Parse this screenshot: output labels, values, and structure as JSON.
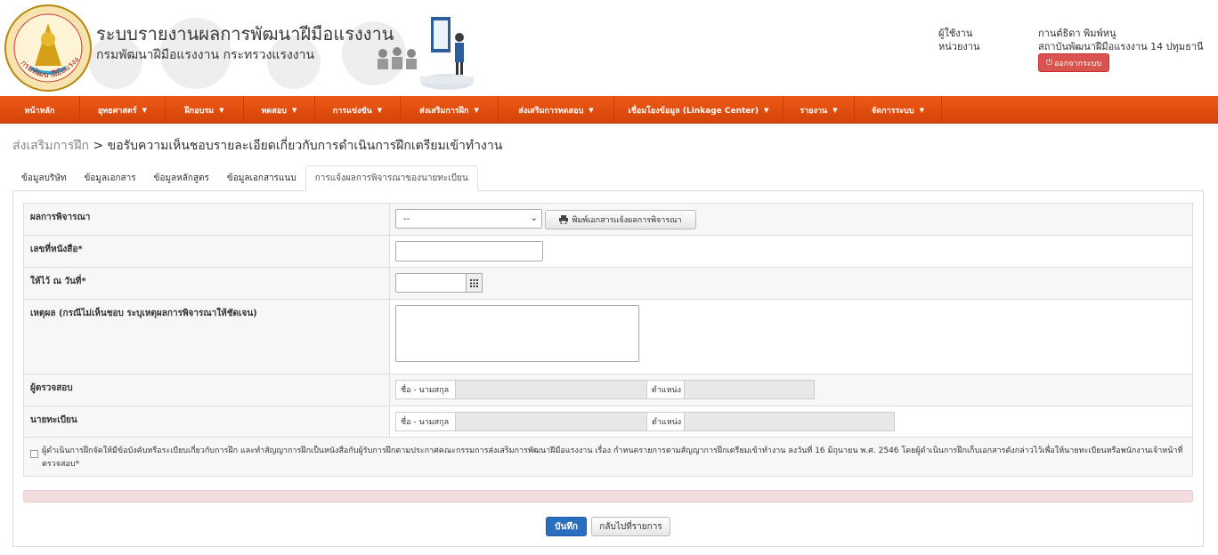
{
  "header": {
    "title": "ระบบรายงานผลการพัฒนาฝีมือแรงงาน",
    "subtitle": "กรมพัฒนาฝีมือแรงงาน กระทรวงแรงงาน",
    "logo_text": "กรมพัฒนาฝีมือแรงงาน",
    "user_label": "ผู้ใช้งาน",
    "unit_label": "หน่วยงาน",
    "user_name": "กานต์ธิดา พิมพ์หนู",
    "unit_name": "สถาบันพัฒนาฝีมือแรงงาน 14 ปทุมธานี",
    "logout_label": "ออกจากระบบ",
    "logout_icon": "power-icon"
  },
  "nav": {
    "items": [
      {
        "label": "หน้าหลัก",
        "dropdown": false
      },
      {
        "label": "ยุทธศาสตร์",
        "dropdown": true
      },
      {
        "label": "ฝึกอบรม",
        "dropdown": true
      },
      {
        "label": "ทดสอบ",
        "dropdown": true
      },
      {
        "label": "การแข่งขัน",
        "dropdown": true
      },
      {
        "label": "ส่งเสริมการฝึก",
        "dropdown": true
      },
      {
        "label": "ส่งเสริมการทดสอบ",
        "dropdown": true
      },
      {
        "label": "เชื่อมโยงข้อมูล (Linkage Center)",
        "dropdown": true
      },
      {
        "label": "รายงาน",
        "dropdown": true
      },
      {
        "label": "จัดการระบบ",
        "dropdown": true
      }
    ],
    "caret": "▼"
  },
  "breadcrumb": {
    "parent": "ส่งเสริมการฝึก",
    "separator": ">",
    "current": "ขอรับความเห็นชอบรายละเอียดเกี่ยวกับการดำเนินการฝึกเตรียมเข้าทำงาน"
  },
  "tabs": [
    {
      "label": "ข้อมูลบริษัท",
      "active": false
    },
    {
      "label": "ข้อมูลเอกสาร",
      "active": false
    },
    {
      "label": "ข้อมูลหลักสูตร",
      "active": false
    },
    {
      "label": "ข้อมูลเอกสารแนบ",
      "active": false
    },
    {
      "label": "การแจ้งผลการพิจารณาของนายทะเบียน",
      "active": true
    }
  ],
  "form": {
    "result_label": "ผลการพิจารณา",
    "result_value": "--",
    "print_label": "พิมพ์เอกสารแจ้งผลการพิจารณา",
    "print_icon": "printer-icon",
    "doc_no_label": "เลขที่หนังสือ*",
    "doc_no_value": "",
    "date_label": "ให้ไว้ ณ วันที่*",
    "date_value": "",
    "calendar_icon": "calendar-grid-icon",
    "reason_label": "เหตุผล (กรณีไม่เห็นชอบ ระบุเหตุผลการพิจารณาให้ชัดเจน)",
    "reason_value": "",
    "inspector_label": "ผู้ตรวจสอบ",
    "registrar_label": "นายทะเบียน",
    "name_addon": "ชื่อ - นามสกุล",
    "position_addon": "ตำแหน่ง",
    "inspector_name": "",
    "inspector_position": "",
    "registrar_name": "",
    "registrar_position": "",
    "consent_text": "ผู้ดำเนินการฝึกจัดให้มีข้อบังคับหรือระเบียบเกี่ยวกับการฝึก และทำสัญญาการฝึกเป็นหนังสือกับผู้รับการฝึกตามประกาศคณะกรรมการส่งเสริมการพัฒนาฝีมือแรงงาน เรื่อง กำหนดรายการตามสัญญาการฝึกเตรียมเข้าทำงาน ลงวันที่ 16 มิถุนายน พ.ศ. 2546 โดยผู้ดำเนินการฝึกเก็บเอกสารดังกล่าวไว้เพื่อให้นายทะเบียนหรือพนักงานเจ้าหน้าที่ตรวจสอบ*",
    "consent_checked": false
  },
  "actions": {
    "save_label": "บันทึก",
    "back_label": "กลับไปที่รายการ"
  },
  "colors": {
    "nav_bg": "#e04e12",
    "primary": "#2a6ebf",
    "danger": "#d9534f",
    "alert_bg": "#f2dede"
  }
}
